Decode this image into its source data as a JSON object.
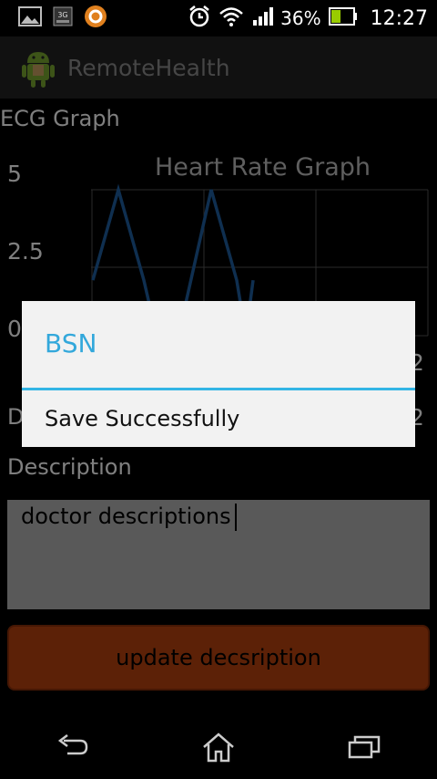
{
  "status_bar": {
    "battery_percent": "36%",
    "time": "12:27",
    "icons": [
      "image-icon",
      "3g-icon",
      "app-notification-icon",
      "alarm-icon",
      "wifi-icon",
      "signal-icon",
      "battery-icon"
    ]
  },
  "app_bar": {
    "title": "RemoteHealth",
    "icon": "android-icon"
  },
  "ecg": {
    "label": "ECG Graph"
  },
  "chart_data": {
    "type": "line",
    "title": "Heart Rate Graph",
    "ytick_labels": [
      "5",
      "2.5",
      "0"
    ],
    "xtick_label_visible": "2",
    "ylim": [
      0,
      5
    ],
    "series": [
      {
        "color": "#1f5fa0",
        "values": [
          1.9,
          5.0,
          1.9,
          0,
          0,
          5.0,
          1.9,
          0,
          1.9
        ]
      }
    ],
    "grid": true
  },
  "partial_label": {
    "left": "D",
    "right": "2"
  },
  "description": {
    "label": "Description",
    "value": "doctor descriptions"
  },
  "update_button": {
    "label": "update decsription",
    "color": "#b8420f"
  },
  "dialog": {
    "title": "BSN",
    "message": "Save Successfully",
    "accent": "#33b5e5"
  },
  "nav_bar": {
    "icons": [
      "back-icon",
      "home-icon",
      "recent-apps-icon"
    ]
  }
}
